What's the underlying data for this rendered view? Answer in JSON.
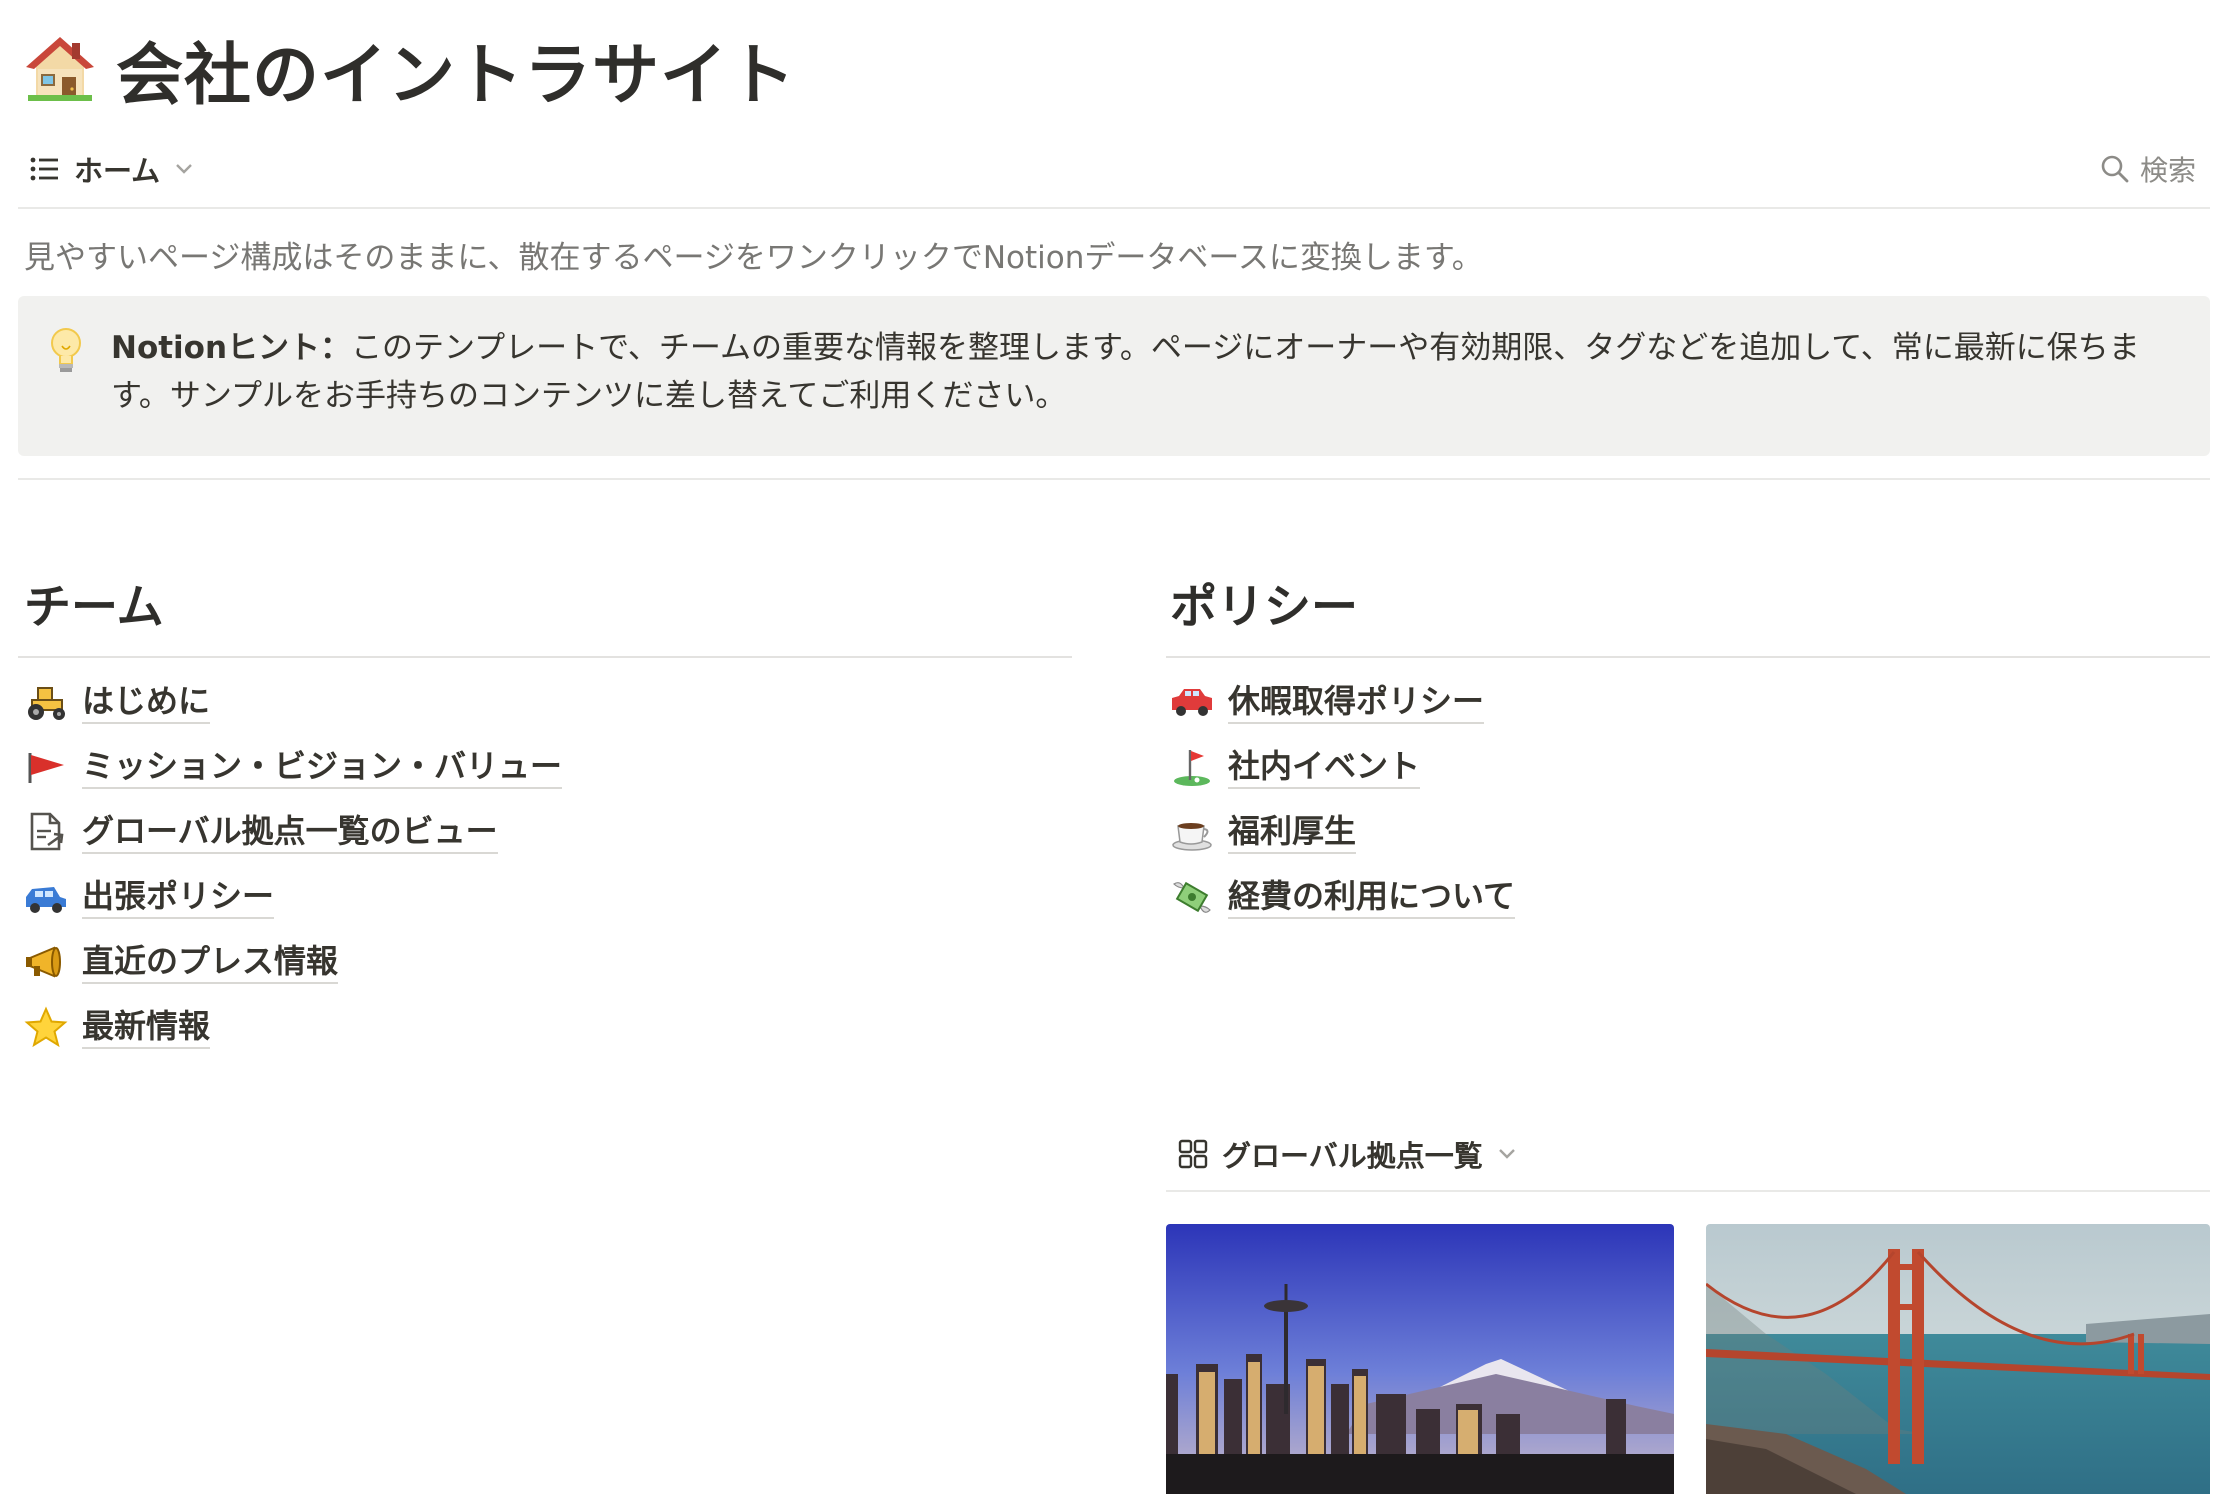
{
  "page": {
    "title": "会社のイントラサイト",
    "title_icon": "house-icon",
    "description": "見やすいページ構成はそのままに、散在するページをワンクリックでNotionデータベースに変換します。"
  },
  "viewbar": {
    "view_label": "ホーム",
    "search_label": "検索"
  },
  "callout": {
    "icon": "lightbulb-icon",
    "bold_label": "Notionヒント：",
    "text": "このテンプレートで、チームの重要な情報を整理します。ページにオーナーや有効期限、タグなどを追加して、常に最新に保ちます。サンプルをお手持ちのコンテンツに差し替えてご利用ください。"
  },
  "team": {
    "heading": "チーム",
    "items": [
      {
        "label": "はじめに",
        "icon": "tractor-icon"
      },
      {
        "label": "ミッション・ビジョン・バリュー",
        "icon": "red-flag-icon"
      },
      {
        "label": "グローバル拠点一覧のビュー",
        "icon": "linked-page-icon"
      },
      {
        "label": "出張ポリシー",
        "icon": "blue-car-icon"
      },
      {
        "label": "直近のプレス情報",
        "icon": "megaphone-icon"
      },
      {
        "label": "最新情報",
        "icon": "star-icon"
      }
    ]
  },
  "policy": {
    "heading": "ポリシー",
    "items": [
      {
        "label": "休暇取得ポリシー",
        "icon": "red-car-icon"
      },
      {
        "label": "社内イベント",
        "icon": "golf-flag-icon"
      },
      {
        "label": "福利厚生",
        "icon": "coffee-icon"
      },
      {
        "label": "経費の利用について",
        "icon": "money-wings-icon"
      }
    ]
  },
  "gallery": {
    "label": "グローバル拠点一覧",
    "cards": [
      {
        "image": "seattle-skyline-image"
      },
      {
        "image": "golden-gate-bridge-image"
      }
    ]
  },
  "colors": {
    "text": "#37352f",
    "muted": "#787774",
    "callout_bg": "#f1f1ef",
    "divider": "#e9e9e7"
  }
}
